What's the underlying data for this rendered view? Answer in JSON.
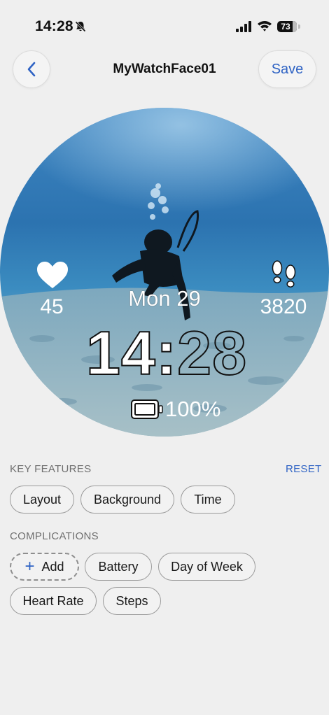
{
  "status_bar": {
    "time": "14:28",
    "battery_percent": "73",
    "icons": [
      "bell-slash-icon",
      "cellular-signal-icon",
      "wifi-icon",
      "battery-icon"
    ]
  },
  "header": {
    "back_icon": "chevron-left-icon",
    "title": "MyWatchFace01",
    "save_label": "Save"
  },
  "watch_face": {
    "heart_rate": "45",
    "date": "Mon 29",
    "steps": "3820",
    "time_hours": "14:",
    "time_minutes": "28",
    "battery": "100%"
  },
  "key_features": {
    "label": "KEY FEATURES",
    "reset_label": "RESET",
    "chips": [
      "Layout",
      "Background",
      "Time"
    ]
  },
  "complications": {
    "label": "COMPLICATIONS",
    "add_label": "Add",
    "chips": [
      "Battery",
      "Day of Week",
      "Heart Rate",
      "Steps"
    ]
  },
  "colors": {
    "accent": "#2f63c4",
    "background": "#efefef"
  }
}
